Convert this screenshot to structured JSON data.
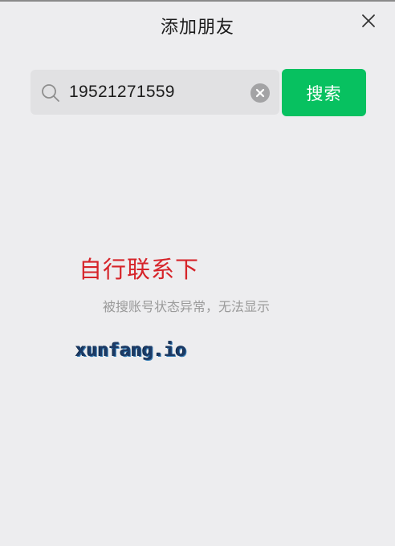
{
  "window": {
    "title": "添加朋友"
  },
  "search": {
    "value": "19521271559",
    "button_label": "搜索"
  },
  "result": {
    "status_message": "被搜账号状态异常，无法显示"
  },
  "overlay": {
    "red_text": "自行联系下",
    "site_text": "xunfang.io"
  },
  "colors": {
    "background": "#ededef",
    "accent": "#07c160",
    "red_text": "#d6242a",
    "site_text": "#1b3a66"
  },
  "icons": {
    "close": "close-icon",
    "search": "search-icon",
    "clear": "clear-icon"
  }
}
